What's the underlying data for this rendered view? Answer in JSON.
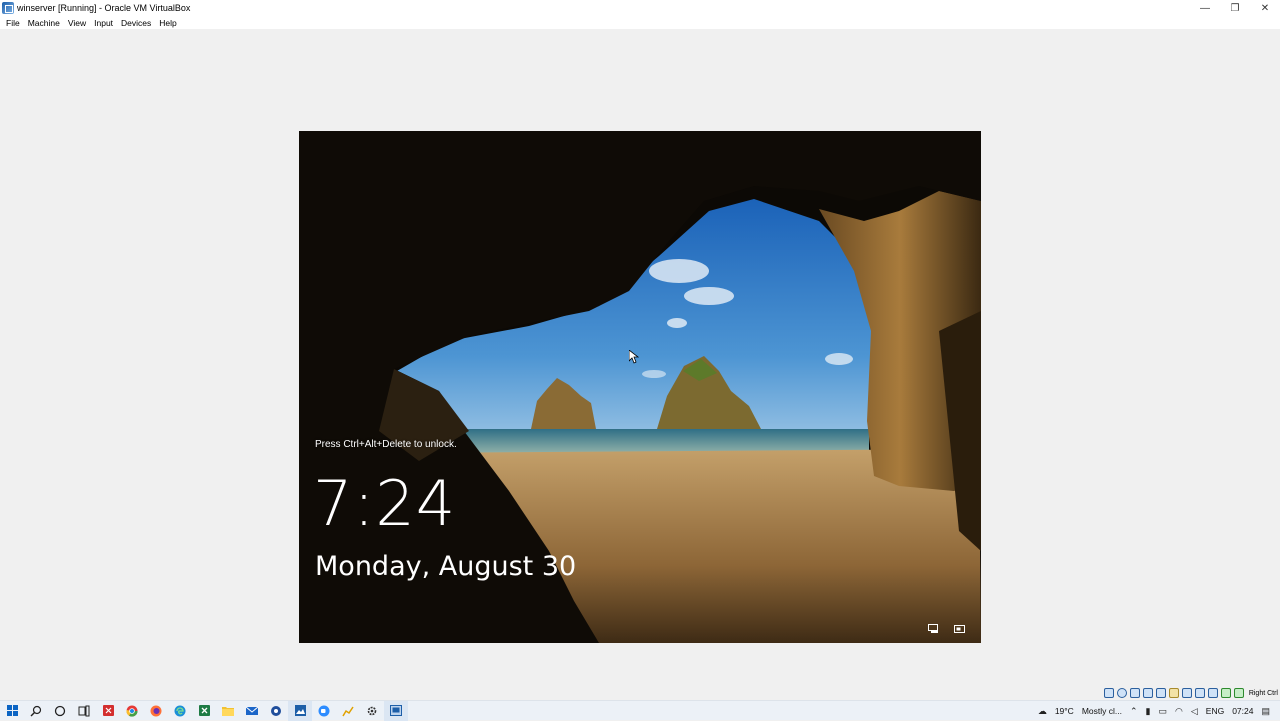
{
  "window": {
    "title": "winserver [Running] - Oracle VM VirtualBox",
    "controls": {
      "minimize": "—",
      "restore": "❐",
      "close": "✕"
    }
  },
  "menubar": {
    "items": [
      {
        "label": "File"
      },
      {
        "label": "Machine"
      },
      {
        "label": "View"
      },
      {
        "label": "Input"
      },
      {
        "label": "Devices"
      },
      {
        "label": "Help"
      }
    ]
  },
  "vm": {
    "unlock_hint": "Press Ctrl+Alt+Delete to unlock.",
    "time": "7:24",
    "date": "Monday, August 30",
    "icons": [
      "network-icon",
      "accessibility-icon"
    ]
  },
  "vbox_status": {
    "icon_names": [
      "hard-disk-icon",
      "optical-drive-icon",
      "audio-icon",
      "network-adapter-icon",
      "usb-icon",
      "shared-folder-icon",
      "display-icon",
      "video-capture-icon",
      "virtualization-icon",
      "mouse-integration-icon",
      "keyboard-icon"
    ],
    "host_key": "Right Ctrl"
  },
  "taskbar": {
    "apps": [
      "windows-start-icon",
      "search-icon",
      "cortana-icon",
      "task-view-icon",
      "app-red-icon",
      "chrome-icon",
      "firefox-icon",
      "edge-icon",
      "excel-icon",
      "file-explorer-icon",
      "mail-icon",
      "app-blue-icon",
      "app-image-icon",
      "zoom-icon",
      "app-chart-icon",
      "settings-icon",
      "virtualbox-icon"
    ],
    "weather_temp": "19°C",
    "weather_text": "Mostly cl...",
    "lang": "ENG",
    "clock": "07:24",
    "colors": {
      "accent": "#0a64c4",
      "bar": "#ecf1f7"
    }
  }
}
